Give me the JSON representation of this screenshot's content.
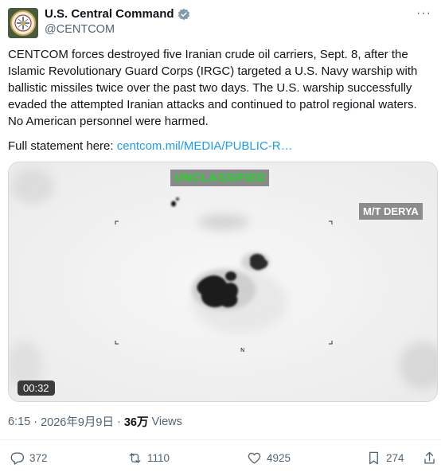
{
  "account": {
    "display_name": "U.S. Central Command",
    "handle": "@CENTCOM",
    "avatar_icon": "centcom-seal-icon",
    "verified_icon": "verified-badge-icon",
    "more_label": "···"
  },
  "tweet": {
    "text": "CENTCOM forces destroyed five Iranian crude oil carriers, Sept. 8, after the Islamic Revolutionary Guard Corps (IRGC) targeted a U.S. Navy warship with ballistic missiles twice over the past two days. The U.S. warship successfully evaded the attempted Iranian attacks and continued to patrol regional waters. No American personnel were harmed.",
    "statement_prefix": "Full statement here: ",
    "statement_link": "centcom.mil/MEDIA/PUBLIC-R…"
  },
  "media": {
    "overlay_top": "UNCLASSIFIED",
    "overlay_label": "M/T DERYA",
    "compass_label": "N",
    "duration": "00:32"
  },
  "meta": {
    "time": "6:15",
    "separator": "·",
    "date": "2026年9月9日",
    "views_count": "36万",
    "views_label": "Views"
  },
  "actions": {
    "reply_count": "372",
    "repost_count": "1110",
    "like_count": "4925",
    "bookmark_count": "274"
  },
  "colors": {
    "link": "#1d9bf0",
    "secondary_text": "#536471",
    "overlay_green": "#21d52a"
  }
}
